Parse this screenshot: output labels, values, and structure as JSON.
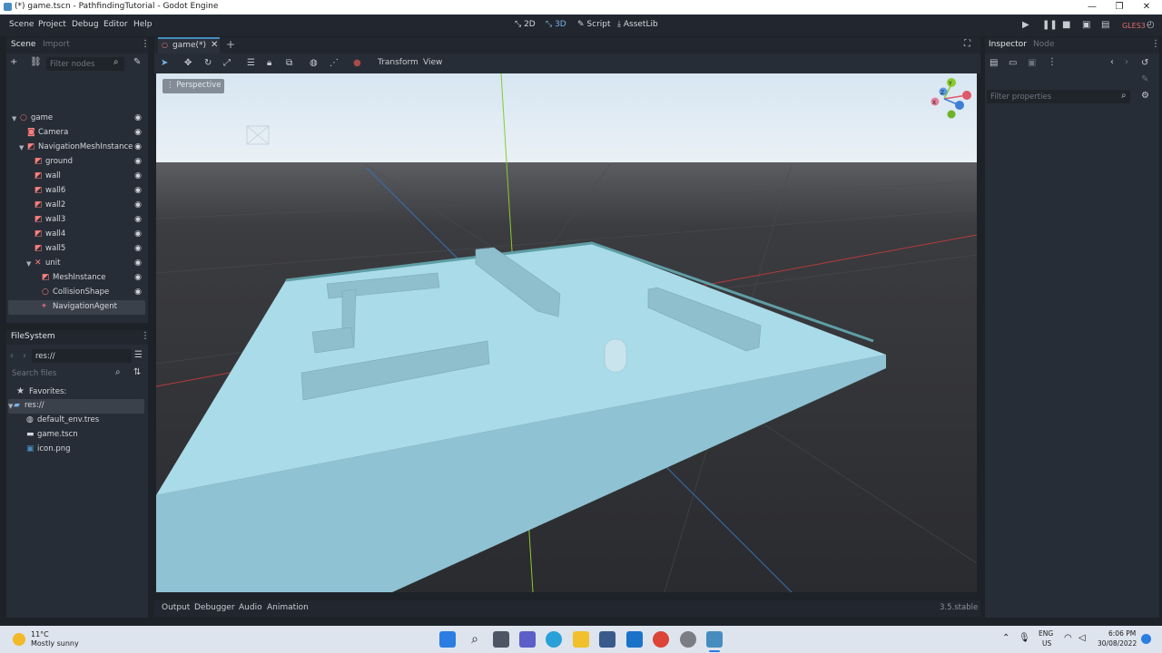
{
  "window": {
    "title": "(*) game.tscn - PathfindingTutorial - Godot Engine",
    "controls": [
      "—",
      "❐",
      "✕"
    ]
  },
  "menu": {
    "items": [
      "Scene",
      "Project",
      "Debug",
      "Editor",
      "Help"
    ],
    "modes": [
      "2D",
      "3D",
      "Script",
      "AssetLib"
    ],
    "renderer": "GLES3"
  },
  "scene_dock": {
    "tabs": [
      "Scene",
      "Import"
    ],
    "filter_placeholder": "Filter nodes",
    "nodes": [
      {
        "label": "game",
        "depth": 0,
        "icon_color": "#e07070",
        "shape": "circle"
      },
      {
        "label": "Camera",
        "depth": 1,
        "icon_color": "#fc7f7f",
        "shape": "cam"
      },
      {
        "label": "NavigationMeshInstance",
        "depth": 1,
        "icon_color": "#fc7f7f",
        "shape": "mesh"
      },
      {
        "label": "ground",
        "depth": 2,
        "icon_color": "#fc7f7f",
        "shape": "mesh"
      },
      {
        "label": "wall",
        "depth": 2,
        "icon_color": "#fc7f7f",
        "shape": "mesh"
      },
      {
        "label": "wall6",
        "depth": 2,
        "icon_color": "#fc7f7f",
        "shape": "mesh"
      },
      {
        "label": "wall2",
        "depth": 2,
        "icon_color": "#fc7f7f",
        "shape": "mesh"
      },
      {
        "label": "wall3",
        "depth": 2,
        "icon_color": "#fc7f7f",
        "shape": "mesh"
      },
      {
        "label": "wall4",
        "depth": 2,
        "icon_color": "#fc7f7f",
        "shape": "mesh"
      },
      {
        "label": "wall5",
        "depth": 2,
        "icon_color": "#fc7f7f",
        "shape": "mesh"
      },
      {
        "label": "unit",
        "depth": 2,
        "icon_color": "#fc7f7f",
        "shape": "body"
      },
      {
        "label": "MeshInstance",
        "depth": 3,
        "icon_color": "#fc7f7f",
        "shape": "mesh"
      },
      {
        "label": "CollisionShape",
        "depth": 3,
        "icon_color": "#fc7f7f",
        "shape": "circle"
      },
      {
        "label": "NavigationAgent",
        "depth": 3,
        "icon_color": "#fc7f7f",
        "shape": "pin"
      }
    ],
    "selected_index": 13
  },
  "filesystem": {
    "title": "FileSystem",
    "path": "res://",
    "search_placeholder": "Search files",
    "favorites_label": "Favorites:",
    "items": [
      {
        "label": "res://",
        "kind": "folder"
      },
      {
        "label": "default_env.tres",
        "kind": "env"
      },
      {
        "label": "game.tscn",
        "kind": "scene"
      },
      {
        "label": "icon.png",
        "kind": "image"
      }
    ]
  },
  "editor": {
    "tab_label": "game(*)",
    "toolbar_menus": [
      "Transform",
      "View"
    ],
    "viewport_label": "Perspective",
    "gizmo_axes": [
      "Y",
      "Z",
      "X"
    ]
  },
  "bottom_panel": {
    "tabs": [
      "Output",
      "Debugger",
      "Audio",
      "Animation"
    ],
    "version": "3.5.stable"
  },
  "inspector": {
    "tabs": [
      "Inspector",
      "Node"
    ],
    "filter_placeholder": "Filter properties"
  },
  "taskbar": {
    "weather_temp": "11°C",
    "weather_desc": "Mostly sunny",
    "lang_1": "ENG",
    "lang_2": "US",
    "time": "6:06 PM",
    "date": "30/08/2022"
  },
  "colors": {
    "accent": "#478cbf",
    "node_icon": "#fc7f7f",
    "sky_top": "#dbe8f2",
    "ground_dark": "#2e2f33",
    "navmesh": "#a9dbe9"
  }
}
